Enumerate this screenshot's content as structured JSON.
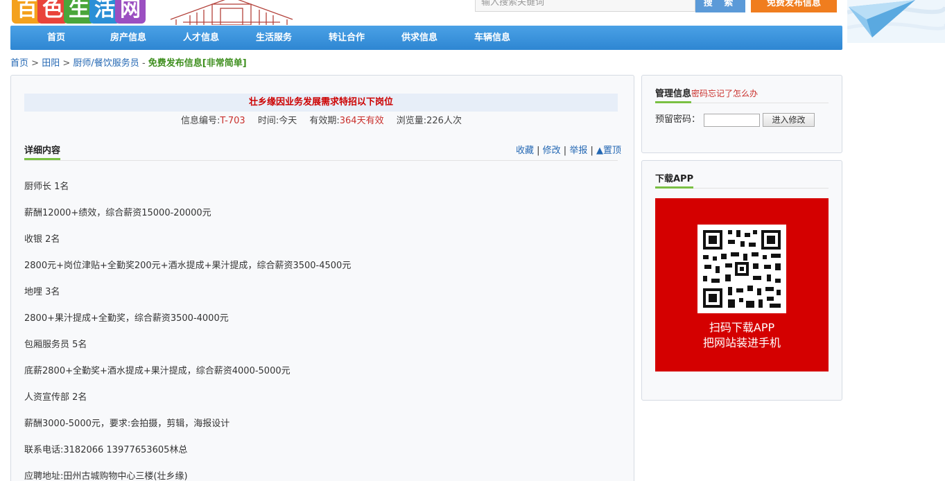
{
  "header": {
    "logo_chars": [
      "百",
      "色",
      "生",
      "活",
      "网"
    ],
    "logo_colors": [
      "#f4a11d",
      "#e9433b",
      "#4aa63b",
      "#2b8fd6",
      "#9b4fc1"
    ],
    "search_placeholder": "输入搜索关键词",
    "search_button": "搜 索",
    "publish_button": "免费发布信息"
  },
  "nav": {
    "items": [
      "首页",
      "房产信息",
      "人才信息",
      "生活服务",
      "转让合作",
      "供求信息",
      "车辆信息"
    ]
  },
  "breadcrumb": {
    "home": "首页",
    "sep1": ">",
    "city": "田阳",
    "sep2": ">",
    "category": "厨师/餐饮服务员",
    "dash": "-",
    "free_post": "免费发布信息[非常简单]"
  },
  "post": {
    "title": "壮乡缘因业务发展需求特招以下岗位",
    "id_label": "信息编号:",
    "id_value": "T-703",
    "time_label": "时间:",
    "time_value": "今天",
    "valid_label": "有效期:",
    "valid_value": "364天有效",
    "views_label": "浏览量:",
    "views_value": "226人次",
    "detail_tab": "详细内容",
    "actions": {
      "favorite": "收藏",
      "edit": "修改",
      "report": "举报",
      "top": "▲置顶"
    },
    "lines": [
      "厨师长 1名",
      "薪酬12000+绩效，综合薪资15000-20000元",
      "收银 2名",
      "2800元+岗位津贴+全勤奖200元+酒水提成+果汁提成，综合薪资3500-4500元",
      "地哩 3名",
      "2800+果汁提成+全勤奖，综合薪资3500-4000元",
      "包厢服务员 5名",
      "底薪2800+全勤奖+酒水提成+果汁提成，综合薪资4000-5000元",
      "人资宣传部 2名",
      "薪酬3000-5000元，要求:会拍摄，剪辑，海报设计",
      "联系电话:3182066 13977653605林总",
      "应聘地址:田州古城购物中心三楼(壮乡缘)"
    ]
  },
  "manage": {
    "title": "管理信息",
    "forgot": "密码忘记了怎么办",
    "pw_label": "预留密码：",
    "enter_button": "进入修改"
  },
  "app": {
    "title": "下载APP",
    "line1": "扫码下载APP",
    "line2": "把网站装进手机",
    "card_color": "#d40000"
  }
}
